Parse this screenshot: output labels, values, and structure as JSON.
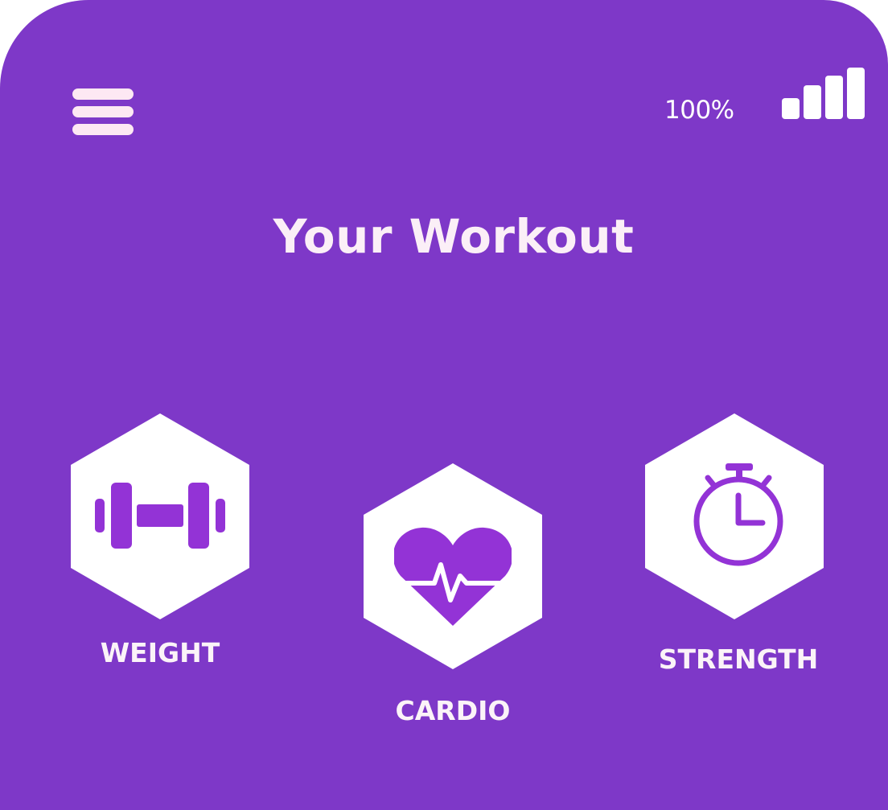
{
  "header": {
    "menu_icon": "hamburger-menu-icon",
    "battery_level": "100%",
    "signal_icon": "signal-strength-icon",
    "signal_bars": 4
  },
  "main": {
    "title": "Your Workout",
    "workouts": [
      {
        "label": "WEIGHT",
        "icon": "dumbbell-icon"
      },
      {
        "label": "CARDIO",
        "icon": "heart-pulse-icon"
      },
      {
        "label": "STRENGTH",
        "icon": "stopwatch-icon"
      }
    ]
  },
  "colors": {
    "background": "#7e38c8",
    "tile": "#ffffff",
    "icon_accent": "#9333d6",
    "text": "#fbf3f8"
  }
}
